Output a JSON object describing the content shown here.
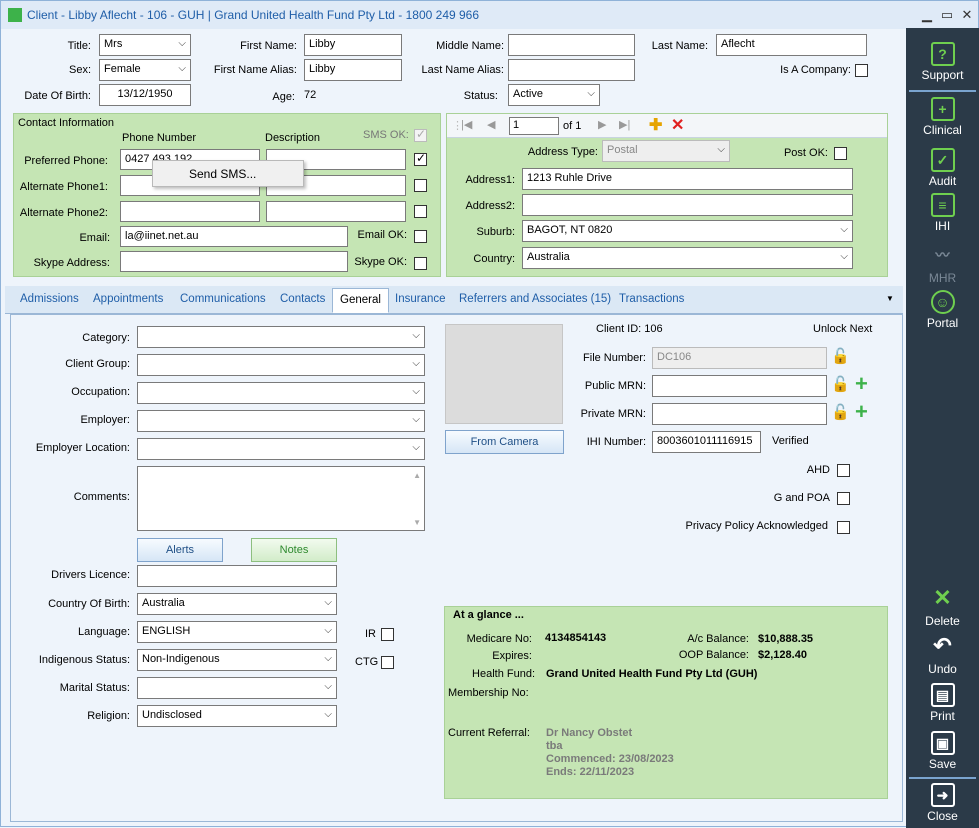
{
  "window": {
    "title": "Client - Libby Aflecht - 106 - GUH | Grand United Health Fund Pty Ltd - 1800 249 966",
    "min": "▁",
    "max": "▭",
    "close": "✕"
  },
  "personal": {
    "title_label": "Title:",
    "title_value": "Mrs",
    "first_name_label": "First Name:",
    "first_name": "Libby",
    "middle_name_label": "Middle Name:",
    "middle_name": "",
    "last_name_label": "Last Name:",
    "last_name": "Aflecht",
    "sex_label": "Sex:",
    "sex_value": "Female",
    "first_alias_label": "First Name Alias:",
    "first_alias": "Libby",
    "last_alias_label": "Last Name Alias:",
    "last_alias": "",
    "is_company_label": "Is A Company:",
    "dob_label": "Date Of Birth:",
    "dob": "13/12/1950",
    "age_label": "Age:",
    "age": "72",
    "status_label": "Status:",
    "status_value": "Active"
  },
  "contact": {
    "header": "Contact Information",
    "phone_col": "Phone Number",
    "desc_col": "Description",
    "sms_ok": "SMS OK:",
    "preferred_label": "Preferred Phone:",
    "preferred_value": "0427 493 192",
    "alt1_label": "Alternate Phone1:",
    "alt2_label": "Alternate Phone2:",
    "email_label": "Email:",
    "email_value": "la@iinet.net.au",
    "email_ok": "Email OK:",
    "skype_label": "Skype Address:",
    "skype_ok": "Skype OK:",
    "context_menu": "Send SMS..."
  },
  "address": {
    "page_value": "1",
    "page_of": "of 1",
    "type_label": "Address  Type:",
    "type_value": "Postal",
    "post_ok": "Post OK:",
    "addr1_label": "Address1:",
    "addr1": "1213 Ruhle Drive",
    "addr2_label": "Address2:",
    "addr2": "",
    "suburb_label": "Suburb:",
    "suburb": "BAGOT, NT 0820",
    "country_label": "Country:",
    "country": "Australia"
  },
  "tabs": [
    "Admissions",
    "Appointments",
    "Communications",
    "Contacts",
    "General",
    "Insurance",
    "Referrers and Associates (15)",
    "Transactions"
  ],
  "general": {
    "category": "Category:",
    "client_group": "Client Group:",
    "occupation": "Occupation:",
    "employer": "Employer:",
    "employer_location": "Employer Location:",
    "comments": "Comments:",
    "alerts_btn": "Alerts",
    "notes_btn": "Notes",
    "drivers_licence": "Drivers Licence:",
    "country_birth_label": "Country Of Birth:",
    "country_birth": "Australia",
    "language_label": "Language:",
    "language": "ENGLISH",
    "ir": "IR",
    "indigenous_label": "Indigenous Status:",
    "indigenous": "Non-Indigenous",
    "ctg": "CTG",
    "marital_label": "Marital Status:",
    "marital": "",
    "religion_label": "Religion:",
    "religion": "Undisclosed",
    "from_camera": "From Camera",
    "client_id": "Client ID: 106",
    "unlock_next": "Unlock Next",
    "file_number_label": "File Number:",
    "file_number": "DC106",
    "public_mrn_label": "Public MRN:",
    "private_mrn_label": "Private MRN:",
    "ihi_label": "IHI Number:",
    "ihi": "8003601011116915",
    "verified": "Verified",
    "ahd": "AHD",
    "g_poa": "G and POA",
    "privacy": "Privacy Policy Acknowledged"
  },
  "glance": {
    "header": "At a glance ...",
    "medicare_label": "Medicare No:",
    "medicare": "4134854143",
    "expires_label": "Expires:",
    "ac_balance_label": "A/c Balance:",
    "ac_balance": "$10,888.35",
    "oop_label": "OOP Balance:",
    "oop": "$2,128.40",
    "fund_label": "Health Fund:",
    "fund": "Grand United Health Fund Pty Ltd (GUH)",
    "membership_label": "Membership No:",
    "referral_label": "Current Referral:",
    "ref_doctor": "Dr Nancy Obstet",
    "ref_tba": "tba",
    "ref_commenced": "Commenced: 23/08/2023",
    "ref_ends": "Ends: 22/11/2023"
  },
  "sidebar": {
    "support": "Support",
    "clinical": "Clinical",
    "audit": "Audit",
    "ihi": "IHI",
    "mhr": "MHR",
    "portal": "Portal",
    "delete": "Delete",
    "undo": "Undo",
    "print": "Print",
    "save": "Save",
    "close": "Close"
  }
}
